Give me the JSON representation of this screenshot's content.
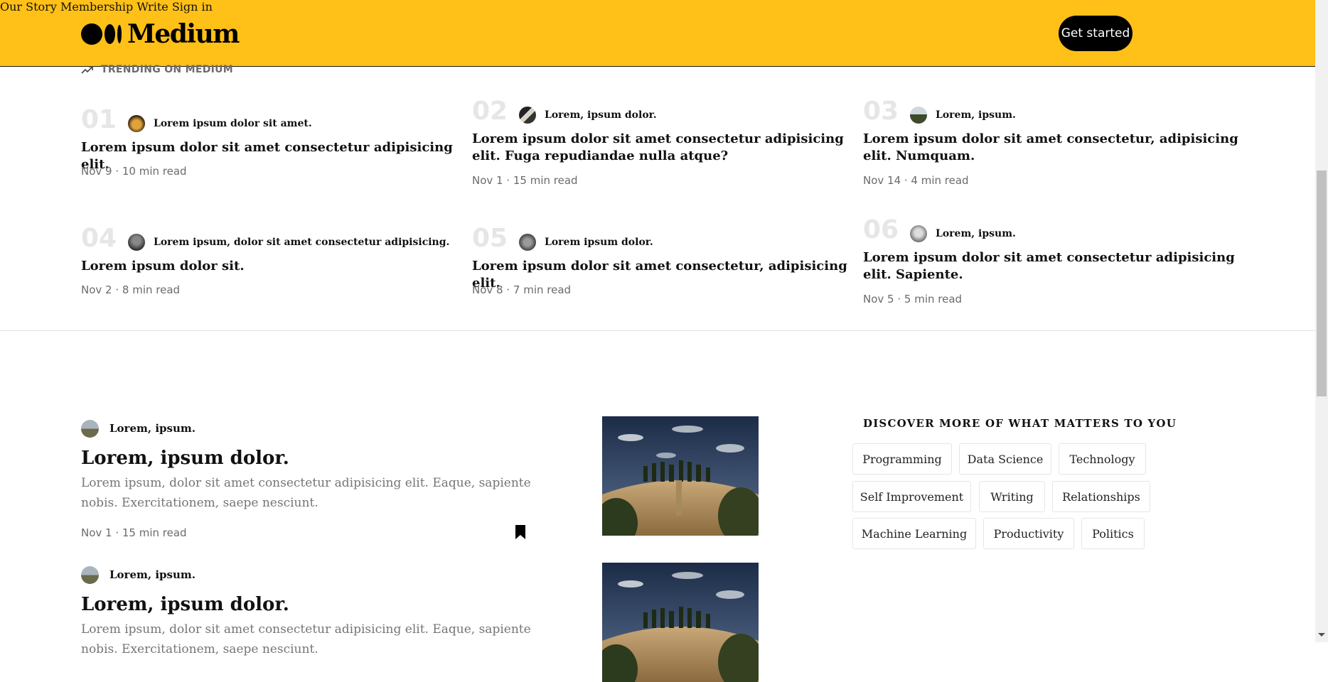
{
  "header": {
    "logo_text": "Medium",
    "nav": [
      "Our Story",
      "Membership",
      "Write",
      "Sign in"
    ],
    "cta": "Get started",
    "bg_color": "#ffc017"
  },
  "trending": {
    "heading": "TRENDING ON MEDIUM",
    "items": [
      {
        "num": "01",
        "author": "Lorem ipsum dolor sit amet.",
        "title": "Lorem ipsum dolor sit amet consectetur adipisicing elit.",
        "meta": "Nov 9 · 10 min read"
      },
      {
        "num": "02",
        "author": "Lorem, ipsum dolor.",
        "title": "Lorem ipsum dolor sit amet consectetur adipisicing elit. Fuga repudiandae nulla atque?",
        "meta": "Nov 1 · 15 min read"
      },
      {
        "num": "03",
        "author": "Lorem, ipsum.",
        "title": "Lorem ipsum dolor sit amet consectetur, adipisicing elit. Numquam.",
        "meta": "Nov 14 · 4 min read"
      },
      {
        "num": "04",
        "author": "Lorem ipsum, dolor sit amet consectetur adipisicing.",
        "title": "Lorem ipsum dolor sit.",
        "meta": "Nov 2 · 8 min read"
      },
      {
        "num": "05",
        "author": "Lorem ipsum dolor.",
        "title": "Lorem ipsum dolor sit amet consectetur, adipisicing elit.",
        "meta": "Nov 8 · 7 min read"
      },
      {
        "num": "06",
        "author": "Lorem, ipsum.",
        "title": "Lorem ipsum dolor sit amet consectetur adipisicing elit. Sapiente.",
        "meta": "Nov 5 · 5 min read"
      }
    ]
  },
  "feed": [
    {
      "author": "Lorem, ipsum.",
      "title": "Lorem, ipsum dolor.",
      "excerpt": "Lorem ipsum, dolor sit amet consectetur adipisicing elit. Eaque, sapiente nobis. Exercitationem, saepe nesciunt.",
      "meta": "Nov 1 · 15 min read"
    },
    {
      "author": "Lorem, ipsum.",
      "title": "Lorem, ipsum dolor.",
      "excerpt": "Lorem ipsum, dolor sit amet consectetur adipisicing elit. Eaque, sapiente nobis. Exercitationem, saepe nesciunt.",
      "meta": ""
    }
  ],
  "discover": {
    "title": "DISCOVER MORE OF WHAT MATTERS TO YOU",
    "topics": [
      "Programming",
      "Data Science",
      "Technology",
      "Self Improvement",
      "Writing",
      "Relationships",
      "Machine Learning",
      "Productivity",
      "Politics"
    ]
  },
  "icons": {
    "trending": "trending-up-icon",
    "bookmark": "bookmark-icon",
    "logo": "medium-logo-icon"
  }
}
